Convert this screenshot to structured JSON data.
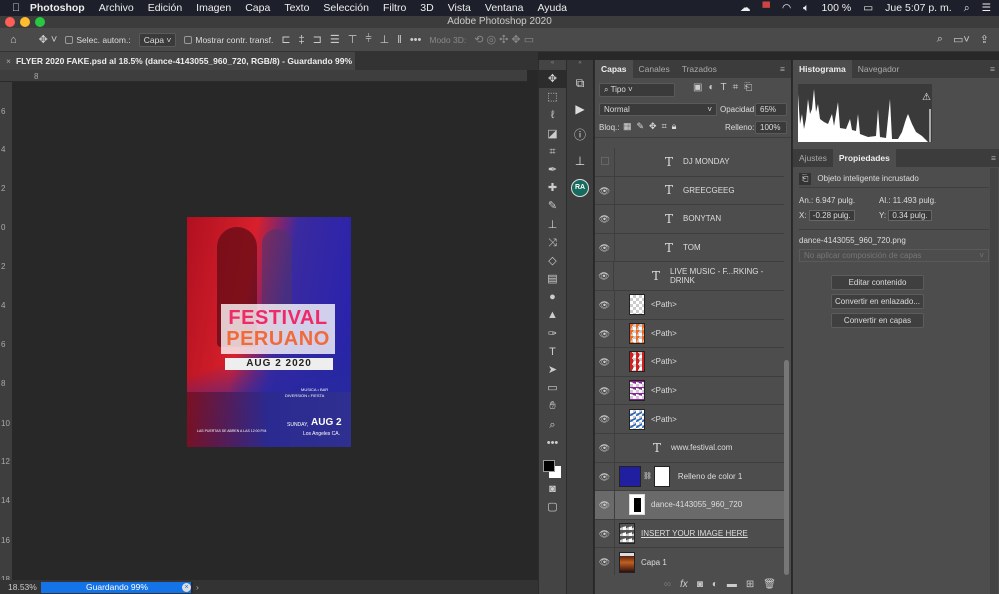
{
  "menubar": {
    "app": "Photoshop",
    "items": [
      "Archivo",
      "Edición",
      "Imagen",
      "Capa",
      "Texto",
      "Selección",
      "Filtro",
      "3D",
      "Vista",
      "Ventana",
      "Ayuda"
    ],
    "battery": "100 %",
    "clock": "Jue 5:07 p. m."
  },
  "window": {
    "title": "Adobe Photoshop 2020"
  },
  "options": {
    "auto_select_label": "Selec. autom.:",
    "auto_select_value": "Capa",
    "show_transform_label": "Mostrar contr. transf.",
    "mode3d_label": "Modo 3D:"
  },
  "document": {
    "tab_title": "FLYER 2020 FAKE.psd al 18.5% (dance-4143055_960_720, RGB/8) - Guardando 99%"
  },
  "rulers": {
    "top": [
      "8"
    ],
    "left": [
      "6",
      "4",
      "2",
      "0",
      "2",
      "4",
      "6",
      "8",
      "10",
      "12",
      "14",
      "16",
      "18"
    ]
  },
  "flyer": {
    "title1": "FESTIVAL",
    "title2": "PERUANO",
    "date": "AUG 2 2020",
    "small1": "MUSICA  •  BAR",
    "small2": "DIVERSION  •  FIESTA",
    "sunday": "SUNDAY,",
    "aug2": "AUG 2",
    "city": "Los Angeles CA.",
    "doors": "LAS PUERTAS SE ABREN A LAS 12:00 P.M."
  },
  "status": {
    "zoom": "18.53%",
    "progress_label": "Guardando 99%",
    "progress": 0.99
  },
  "toolbar": {
    "icons": [
      "move-icon",
      "marquee-icon",
      "lasso-icon",
      "object-select-icon",
      "crop-icon",
      "eyedropper-icon",
      "healing-icon",
      "brush-icon",
      "stamp-icon",
      "history-brush-icon",
      "eraser-icon",
      "gradient-icon",
      "blur-icon",
      "dodge-icon",
      "pen-icon",
      "type-icon",
      "path-select-icon",
      "shape-icon",
      "hand-icon",
      "zoom-icon",
      "more-icon"
    ]
  },
  "mini_panel": {
    "avatar": "RA"
  },
  "layers_panel": {
    "tabs": [
      "Capas",
      "Canales",
      "Trazados"
    ],
    "filter": "Tipo",
    "blend_mode": "Normal",
    "opacity_label": "Opacidad:",
    "opacity": "65%",
    "lock_label": "Bloq.:",
    "fill_label": "Relleno:",
    "fill": "100%",
    "layers": [
      {
        "name": "DJ MONDAY",
        "kind": "text",
        "visible": false
      },
      {
        "name": "GREECGEEG",
        "kind": "text",
        "visible": true
      },
      {
        "name": "BONYTAN",
        "kind": "text",
        "visible": true
      },
      {
        "name": "TOM",
        "kind": "text",
        "visible": true
      },
      {
        "name": "LIVE MUSIC - F...RKING - DRINK",
        "kind": "text",
        "visible": true
      },
      {
        "name": "<Path>",
        "kind": "path",
        "visible": true
      },
      {
        "name": "<Path>",
        "kind": "path",
        "visible": true
      },
      {
        "name": "<Path>",
        "kind": "path",
        "visible": true
      },
      {
        "name": "<Path>",
        "kind": "path",
        "visible": true
      },
      {
        "name": "<Path>",
        "kind": "path",
        "visible": true
      },
      {
        "name": "www.festival.com",
        "kind": "text",
        "visible": true
      },
      {
        "name": "Relleno de color 1",
        "kind": "fill",
        "visible": true
      },
      {
        "name": "dance-4143055_960_720",
        "kind": "smart",
        "visible": true,
        "selected": true
      },
      {
        "name": "INSERT YOUR IMAGE HERE",
        "kind": "image",
        "visible": true
      },
      {
        "name": "Capa 1",
        "kind": "image",
        "visible": true
      }
    ]
  },
  "histogram_panel": {
    "tabs": [
      "Histograma",
      "Navegador"
    ]
  },
  "properties_panel": {
    "tabs": [
      "Ajustes",
      "Propiedades"
    ],
    "type": "Objeto inteligente incrustado",
    "width_label": "An.:",
    "width": "6.947 pulg.",
    "height_label": "Al.:",
    "height": "11.493 pulg.",
    "x_label": "X:",
    "x": "-0.28 pulg.",
    "y_label": "Y:",
    "y": "0.34 pulg.",
    "file": "dance-4143055_960_720.png",
    "comp_placeholder": "No aplicar composición de capas",
    "buttons": [
      "Editar contenido",
      "Convertir en enlazado...",
      "Convertir en capas"
    ]
  },
  "colors": {
    "accent": "#1473e6",
    "fill_layer": "#1f1fa0"
  }
}
